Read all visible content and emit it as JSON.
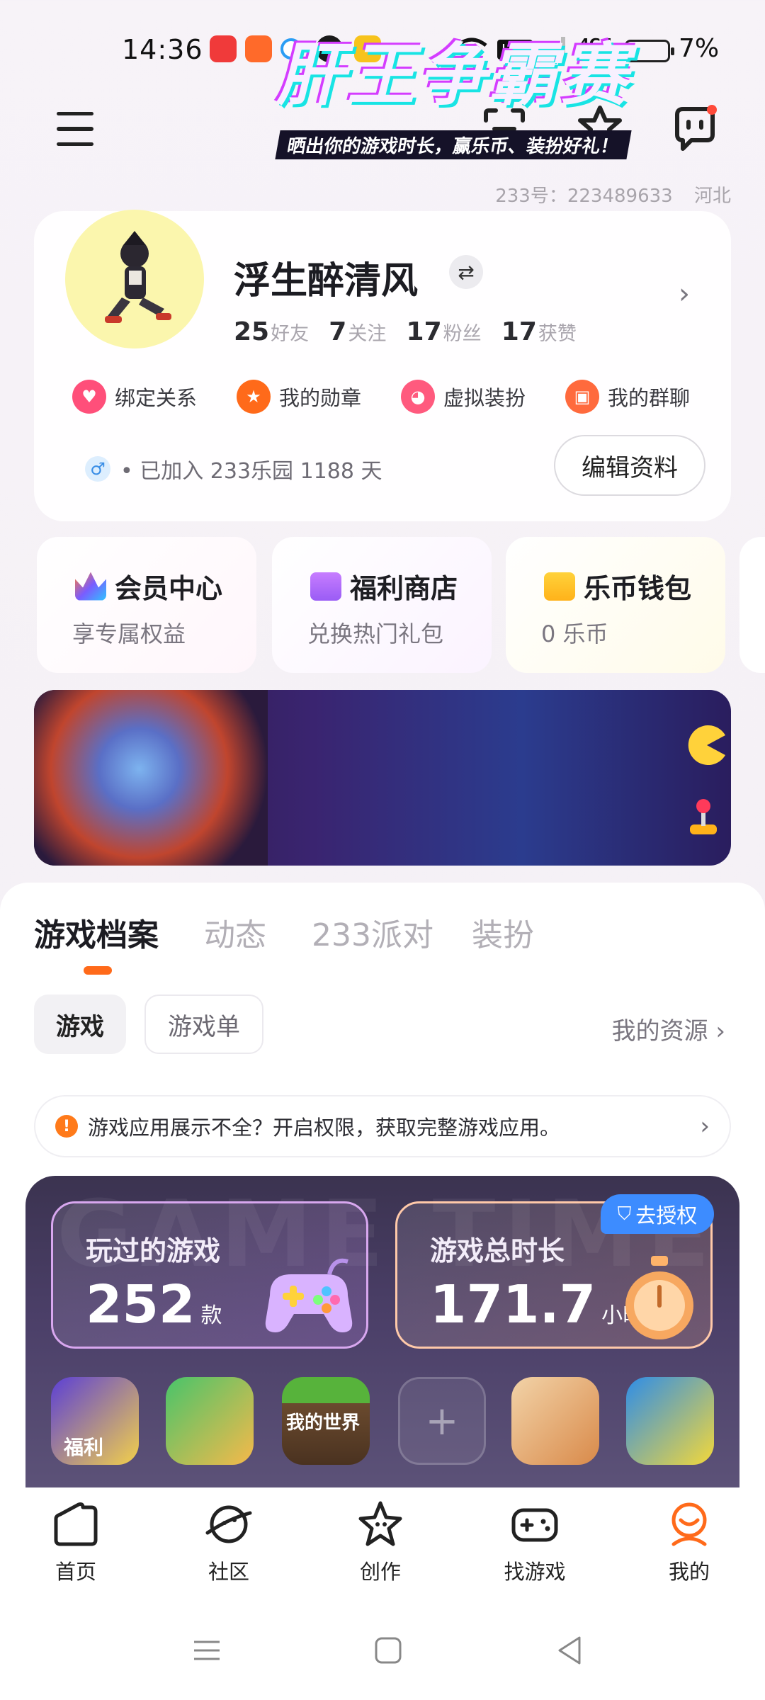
{
  "status_bar": {
    "time": "14:36",
    "network": "HD₂",
    "cell": "4G",
    "battery_percent": "7%",
    "battery_level": 0.07,
    "app_icons": [
      "music-app",
      "grid-app",
      "search-app",
      "wechat-app",
      "coupon-app"
    ]
  },
  "header": {
    "account_id": "233号：223489633",
    "region": "河北"
  },
  "profile": {
    "username": "浮生醉清风",
    "stats": [
      {
        "num": "25",
        "label": "好友"
      },
      {
        "num": "7",
        "label": "关注"
      },
      {
        "num": "17",
        "label": "粉丝"
      },
      {
        "num": "17",
        "label": "获赞"
      }
    ],
    "quick_links": [
      {
        "label": "绑定关系",
        "icon": "heart-icon",
        "color": "#ff4f7a"
      },
      {
        "label": "我的勋章",
        "icon": "medal-icon",
        "color": "#ff6a1a"
      },
      {
        "label": "虚拟装扮",
        "icon": "cat-icon",
        "color": "#ff5a7e"
      },
      {
        "label": "我的群聊",
        "icon": "chat-icon",
        "color": "#ff6a3d"
      }
    ],
    "joined_text": "• 已加入 233乐园 1188 天",
    "edit_button": "编辑资料"
  },
  "features": [
    {
      "title": "会员中心",
      "sub": "享专属权益"
    },
    {
      "title": "福利商店",
      "sub": "兑换热门礼包"
    },
    {
      "title": "乐币钱包",
      "sub": "0 乐币"
    }
  ],
  "banner": {
    "title": "肝王争霸赛",
    "subtitle": "晒出你的游戏时长，赢乐币、装扮好礼！"
  },
  "tabs": [
    "游戏档案",
    "动态",
    "233派对",
    "装扮"
  ],
  "chips": [
    "游戏",
    "游戏单"
  ],
  "resources_link": "我的资源 ›",
  "permission_notice": "游戏应用展示不全？开启权限，获取完整游戏应用。",
  "panel": {
    "watermark": "GAME TIME",
    "played_label": "玩过的游戏",
    "played_value": "252",
    "played_unit": "款",
    "time_label": "游戏总时长",
    "time_value": "171.7",
    "time_unit": "小时",
    "authorize": "去授权",
    "games": [
      {
        "name": "福利",
        "colors": [
          "#5b3fd6",
          "#f3d04a"
        ]
      },
      {
        "name": "",
        "colors": [
          "#48c46a",
          "#f6b94a"
        ]
      },
      {
        "name": "我的世界",
        "colors": [
          "#6a4a2e",
          "#57b33b"
        ]
      },
      {
        "name": "",
        "colors": [
          "#f2d3a8",
          "#d98a4a"
        ]
      },
      {
        "name": "",
        "colors": [
          "#2e8de8",
          "#f3d83a"
        ]
      }
    ]
  },
  "bottom_nav": [
    {
      "label": "首页",
      "icon": "home-icon"
    },
    {
      "label": "社区",
      "icon": "planet-icon"
    },
    {
      "label": "创作",
      "icon": "star-icon"
    },
    {
      "label": "找游戏",
      "icon": "gamepad-icon"
    },
    {
      "label": "我的",
      "icon": "profile-icon"
    }
  ],
  "colors": {
    "accent": "#ff6a1a",
    "authorize_blue": "#3d8cff"
  }
}
